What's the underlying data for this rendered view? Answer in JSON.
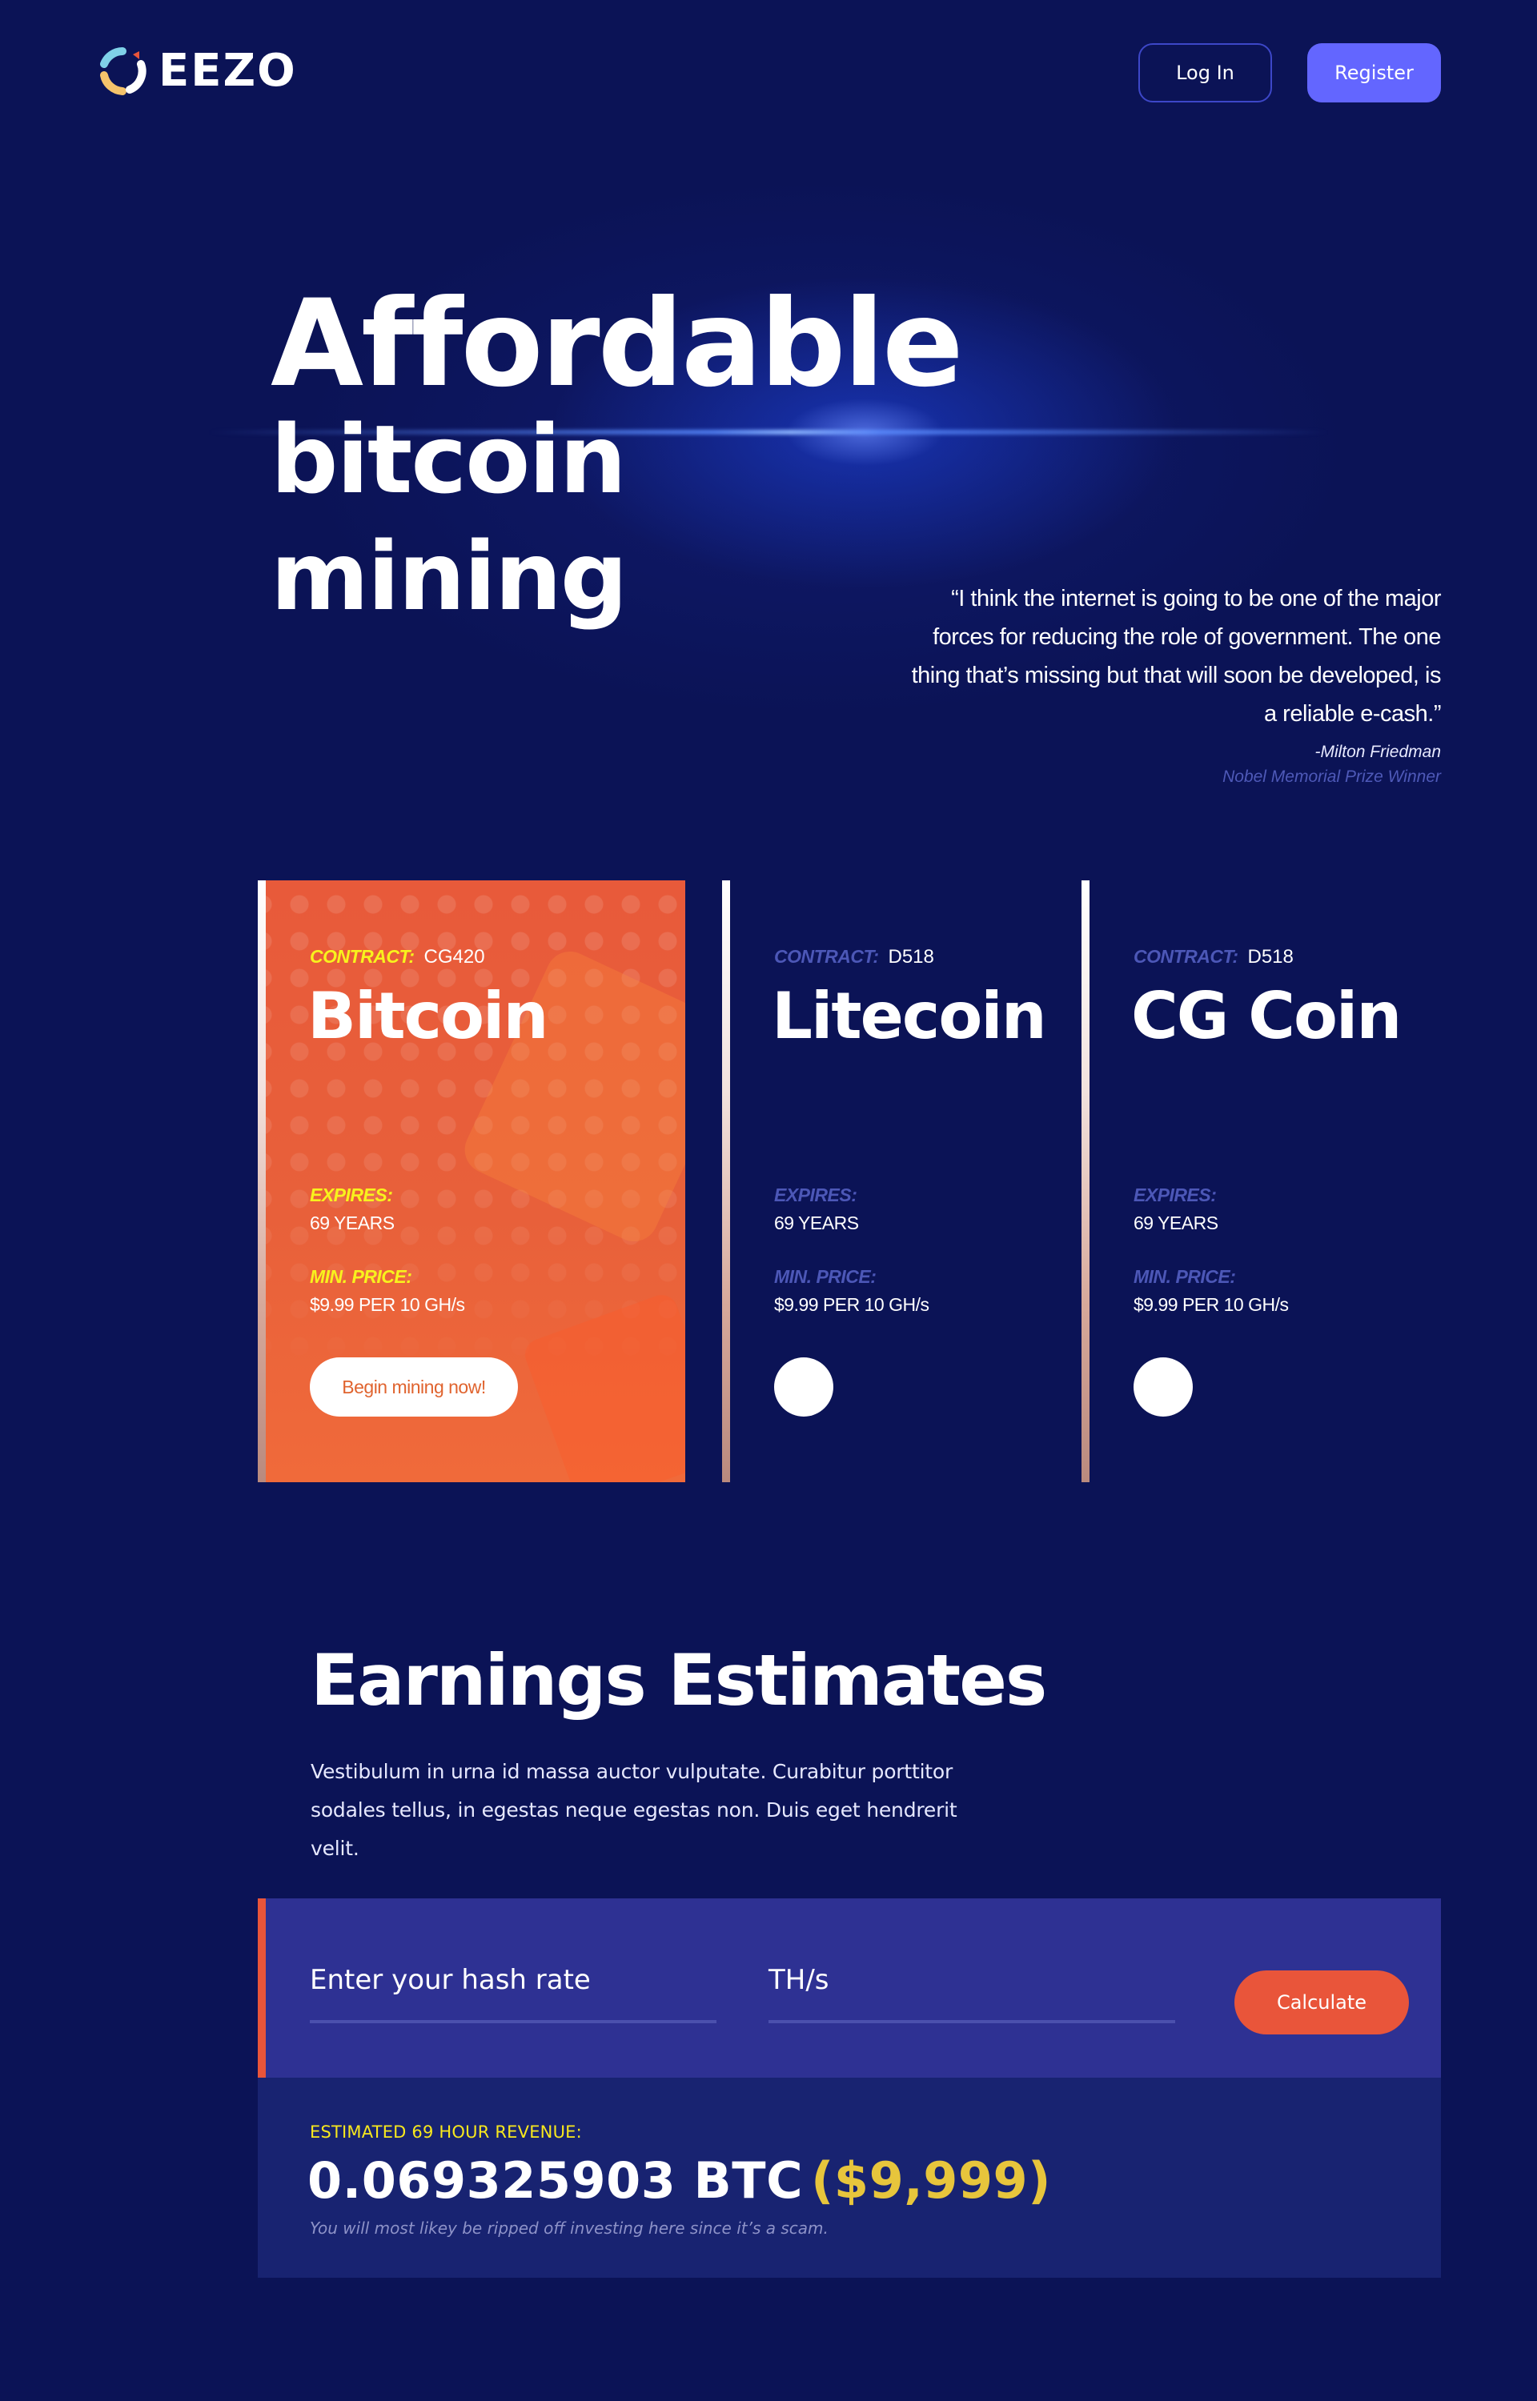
{
  "header": {
    "logo_text": "EEZO",
    "login_label": "Log In",
    "register_label": "Register"
  },
  "hero": {
    "title_part1": "Affordable",
    "title_part2": "bitcoin",
    "title_part3": "mining",
    "quote": "“I think the internet is going to be one of the major forces for reducing the role of government. The one thing that’s missing but that will soon be developed, is a reliable e-cash.”",
    "quote_author": "-Milton Friedman",
    "quote_author_title": "Nobel Memorial Prize Winner"
  },
  "contracts": [
    {
      "contract_label": "CONTRACT:",
      "contract_id": "CG420",
      "name": "Bitcoin",
      "expires_label": "EXPIRES:",
      "expires_value": "69 YEARS",
      "price_label": "MIN. PRICE:",
      "price_value": "$9.99 PER 10 GH/s",
      "cta_label": "Begin mining now!",
      "active": true
    },
    {
      "contract_label": "CONTRACT:",
      "contract_id": "D518",
      "name": "Litecoin",
      "expires_label": "EXPIRES:",
      "expires_value": "69 YEARS",
      "price_label": "MIN. PRICE:",
      "price_value": "$9.99 PER 10 GH/s",
      "active": false
    },
    {
      "contract_label": "CONTRACT:",
      "contract_id": "D518",
      "name": "CG Coin",
      "expires_label": "EXPIRES:",
      "expires_value": "69 YEARS",
      "price_label": "MIN. PRICE:",
      "price_value": "$9.99 PER 10 GH/s",
      "active": false
    }
  ],
  "earnings": {
    "title": "Earnings Estimates",
    "description": "Vestibulum in urna id massa auctor vulputate. Curabitur porttitor sodales tellus, in egestas neque egestas non. Duis eget hendrerit velit.",
    "hash_placeholder": "Enter your hash rate",
    "unit_placeholder": "TH/s",
    "calculate_label": "Calculate",
    "result_label": "ESTIMATED 69 HOUR REVENUE:",
    "result_btc": "0.069325903 BTC",
    "result_usd": "($9,999)",
    "result_note": "You will most likey be ripped off investing here since it’s a scam."
  },
  "colors": {
    "background": "#0b1356",
    "accent_orange": "#e9553a",
    "accent_purple": "#6366ff",
    "label_yellow": "#f8f21d",
    "muted_label": "#4c57b7",
    "calc_panel": "#2e3193",
    "result_panel": "#182371"
  }
}
